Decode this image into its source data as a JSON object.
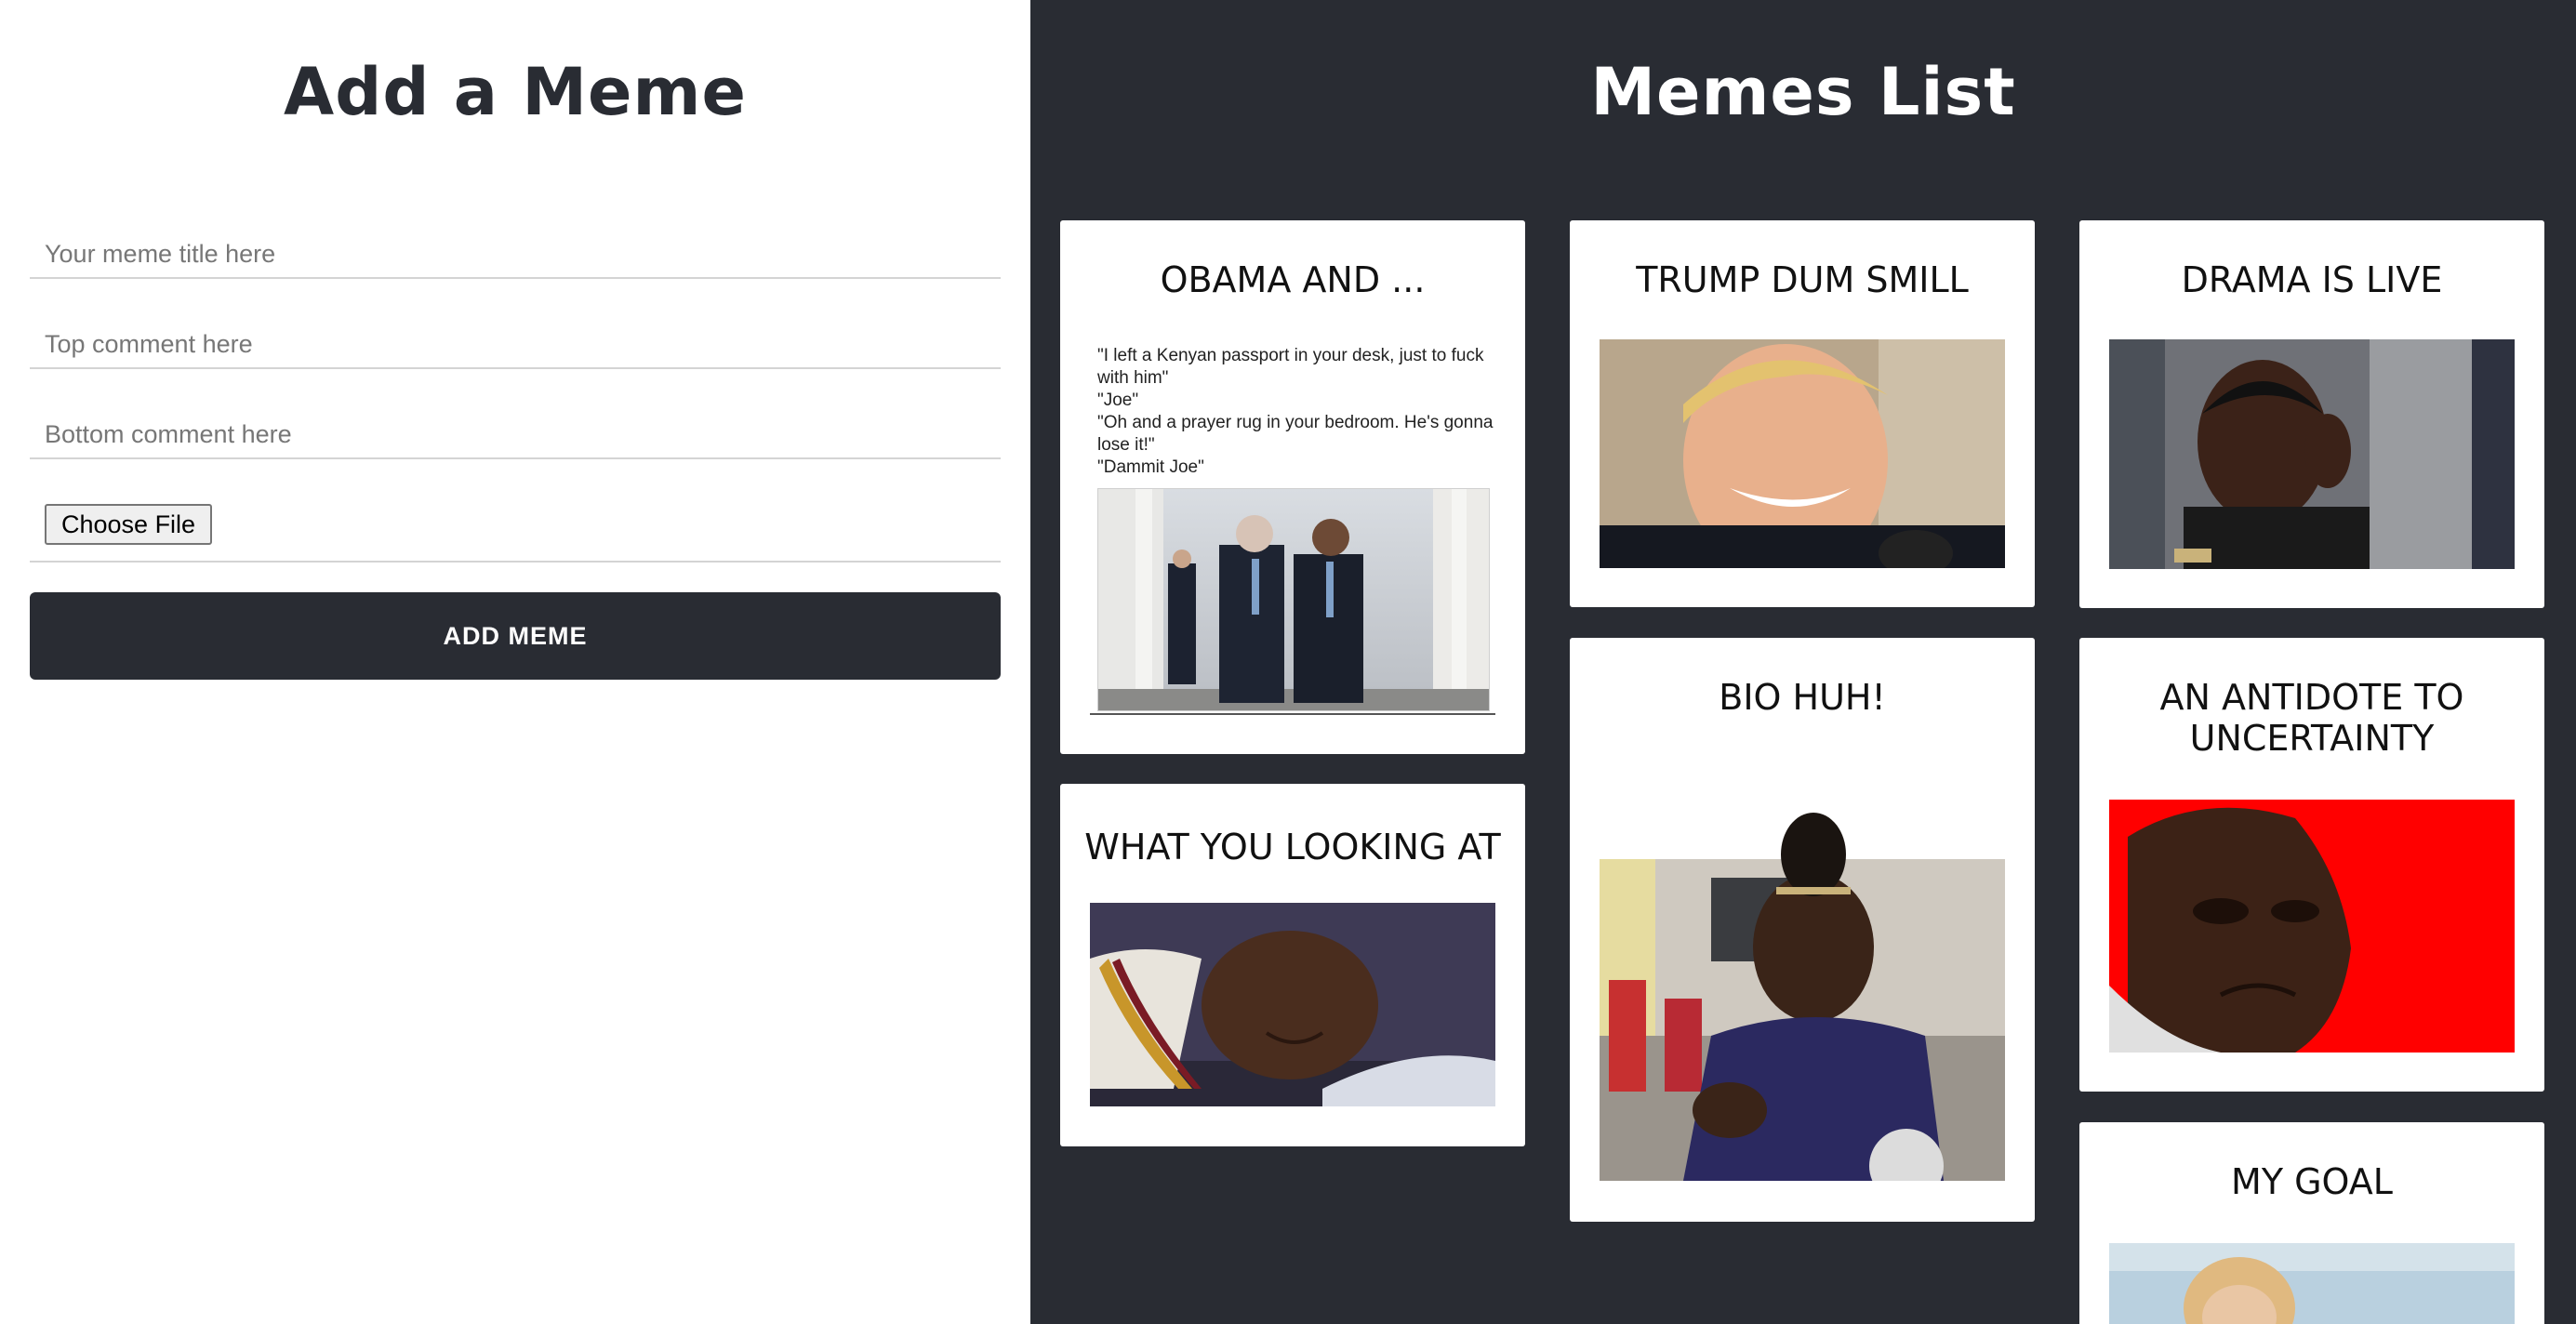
{
  "form": {
    "heading": "Add a Meme",
    "title_placeholder": "Your meme title here",
    "top_placeholder": "Top comment here",
    "bottom_placeholder": "Bottom comment here",
    "file_button": "Choose File",
    "submit_label": "ADD MEME"
  },
  "list": {
    "heading": "Memes List",
    "memes": [
      {
        "title": "OBAMA AND ...",
        "caption_lines": [
          "\"I left a Kenyan passport in your desk, just to fuck with him\"",
          "\"Joe\"",
          "\"Oh and a prayer rug in your bedroom. He's gonna lose it!\"",
          "\"Dammit Joe\""
        ]
      },
      {
        "title": "TRUMP DUM SMILL"
      },
      {
        "title": "DRAMA IS LIVE"
      },
      {
        "title": "WHAT YOU LOOKING AT"
      },
      {
        "title": "BIO HUH!"
      },
      {
        "title": "AN ANTIDOTE TO UNCERTAINTY"
      },
      {
        "title": "MY GOAL"
      }
    ]
  },
  "colors": {
    "dark_panel": "#292c33",
    "button_bg": "#292c33",
    "card_bg": "#ffffff",
    "meme6_bg": "#ff0000"
  }
}
